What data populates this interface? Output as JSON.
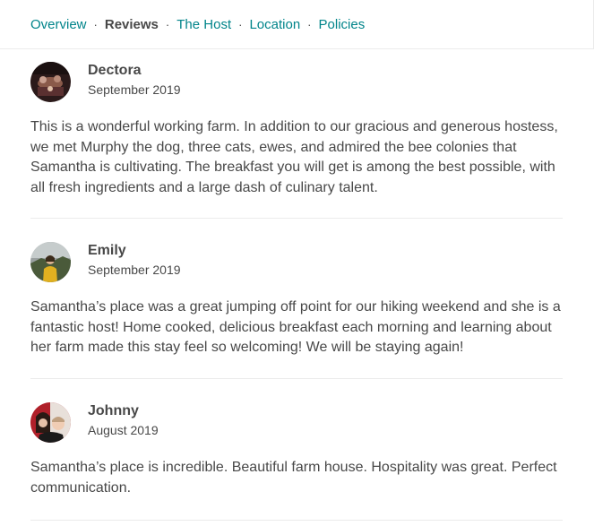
{
  "nav": {
    "items": [
      {
        "label": "Overview",
        "active": false
      },
      {
        "label": "Reviews",
        "active": true
      },
      {
        "label": "The Host",
        "active": false
      },
      {
        "label": "Location",
        "active": false
      },
      {
        "label": "Policies",
        "active": false
      }
    ],
    "separator": "·"
  },
  "reviews": [
    {
      "name": "Dectora",
      "date": "September 2019",
      "text": "This is a wonderful working farm. In addition to our gracious and generous hostess, we met Murphy the dog, three cats, ewes, and admired the bee colonies that Samantha is cultivating. The breakfast you will get is among the best possible, with all fresh ingredients and a large dash of culinary talent."
    },
    {
      "name": "Emily",
      "date": "September 2019",
      "text": "Samantha’s place was a great jumping off point for our hiking weekend and she is a fantastic host! Home cooked, delicious breakfast each morning and learning about her farm made this stay feel so welcoming! We will be staying again!"
    },
    {
      "name": "Johnny",
      "date": "August 2019",
      "text": "Samantha’s place is incredible. Beautiful farm house. Hospitality was great. Perfect communication."
    }
  ],
  "colors": {
    "link": "#00848a",
    "text": "#484848",
    "divider": "#ebebeb"
  }
}
